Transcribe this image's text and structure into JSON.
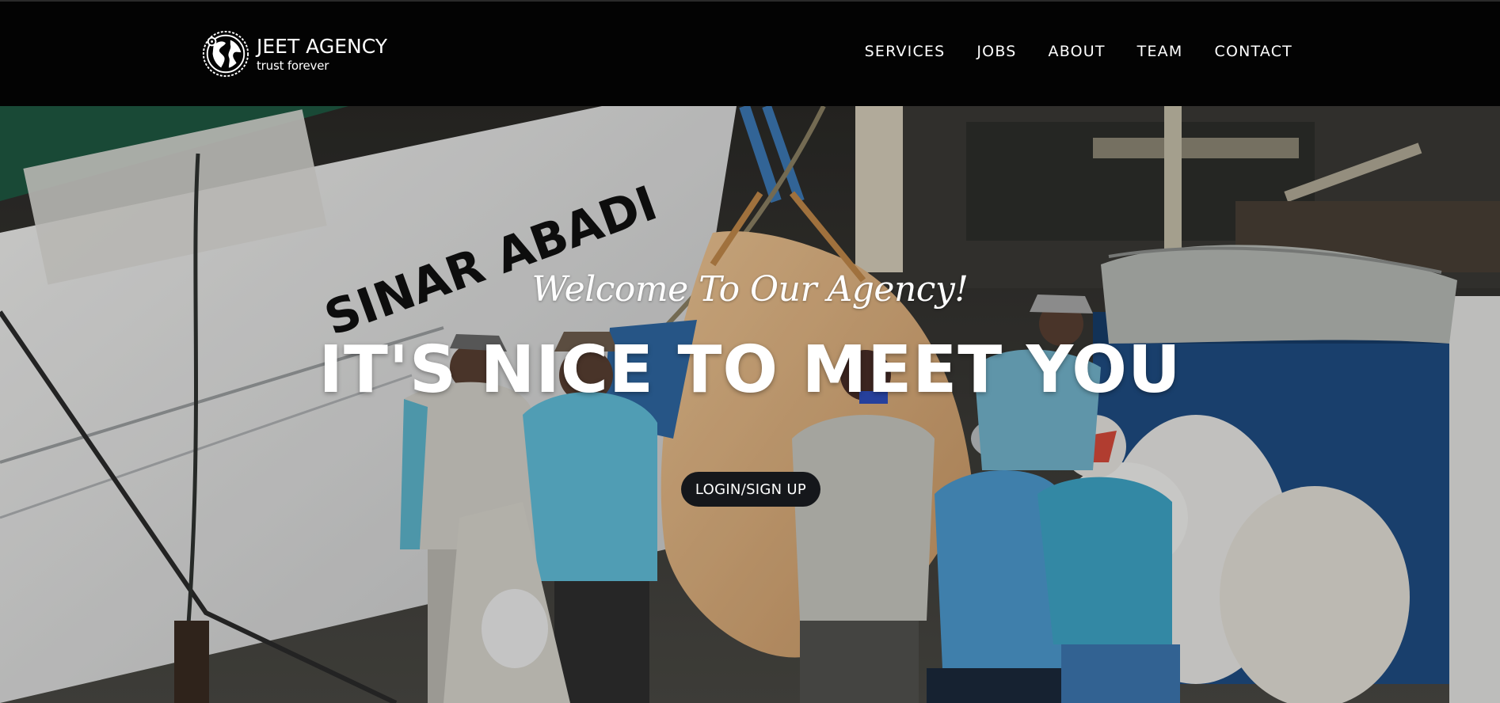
{
  "brand": {
    "name": "JEET AGENCY",
    "tagline": "trust forever",
    "logo_icon": "globe-icon"
  },
  "nav": {
    "items": [
      {
        "label": "SERVICES"
      },
      {
        "label": "JOBS"
      },
      {
        "label": "ABOUT"
      },
      {
        "label": "TEAM"
      },
      {
        "label": "CONTACT"
      }
    ]
  },
  "hero": {
    "welcome": "Welcome To Our Agency!",
    "headline": "IT'S NICE TO MEET YOU",
    "cta_label": "LOGIN/SIGN UP",
    "ship_name": "SINAR ABADI"
  },
  "colors": {
    "navbar_bg": "#030303",
    "text": "#ffffff",
    "cta_bg": "#15171b"
  }
}
